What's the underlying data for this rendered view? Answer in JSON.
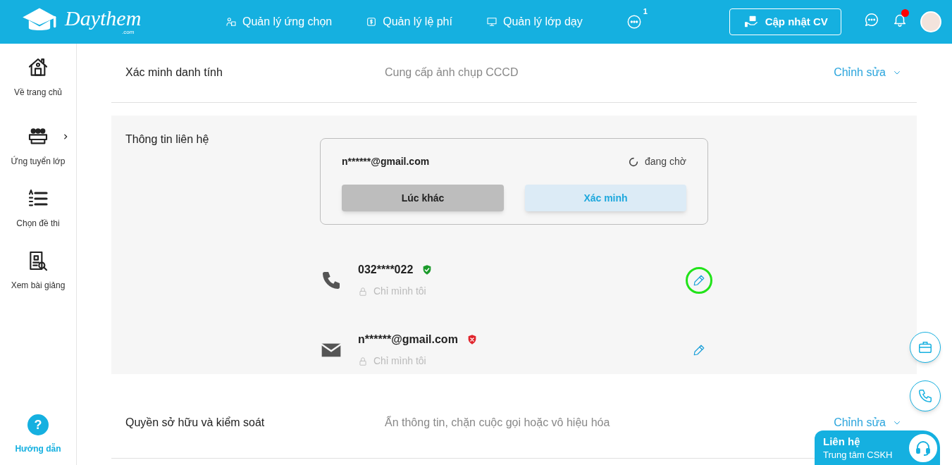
{
  "header": {
    "logo_text": "Daythem",
    "logo_sub": ".com",
    "nav": [
      {
        "kind": "people",
        "label": "Quản lý ứng chọn"
      },
      {
        "kind": "fee",
        "label": "Quản lý lệ phí"
      },
      {
        "kind": "class",
        "label": "Quản lý lớp dạy"
      }
    ],
    "more_badge": "1",
    "cv_button": "Cập nhật CV",
    "notification_dot": true
  },
  "sidebar": {
    "items": [
      {
        "kind": "home",
        "label": "Về trang chủ",
        "expandable": false
      },
      {
        "kind": "classes",
        "label": "Ứng tuyển lớp",
        "expandable": true
      },
      {
        "kind": "test",
        "label": "Chọn đề thi",
        "expandable": false
      },
      {
        "kind": "lecture",
        "label": "Xem bài giảng",
        "expandable": false
      }
    ],
    "help": {
      "icon": "?",
      "label": "Hướng dẫn"
    }
  },
  "sections": [
    {
      "kind": "collapsed",
      "title": "Xác minh danh tính",
      "description": "Cung cấp ảnh chụp CCCD",
      "action": "Chỉnh sửa"
    },
    {
      "kind": "contact",
      "title": "Thông tin liên hệ",
      "pending": {
        "email": "n******@gmail.com",
        "status": "đang chờ",
        "later_button": "Lúc khác",
        "verify_button": "Xác minh"
      },
      "contacts": [
        {
          "kind": "phone",
          "value": "032****022",
          "verified": true,
          "privacy": "Chỉ mình tôi",
          "highlighted": true
        },
        {
          "kind": "email",
          "value": "n******@gmail.com",
          "verified": false,
          "privacy": "Chỉ mình tôi",
          "highlighted": false
        }
      ]
    },
    {
      "kind": "collapsed",
      "title": "Quyền sở hữu và kiểm soát",
      "description": "Ẩn thông tin, chặn cuộc gọi hoặc vô hiệu hóa",
      "action": "Chỉnh sửa"
    }
  ],
  "contact_widget": {
    "title": "Liên hệ",
    "subtitle": "Trung tâm CSKH"
  }
}
